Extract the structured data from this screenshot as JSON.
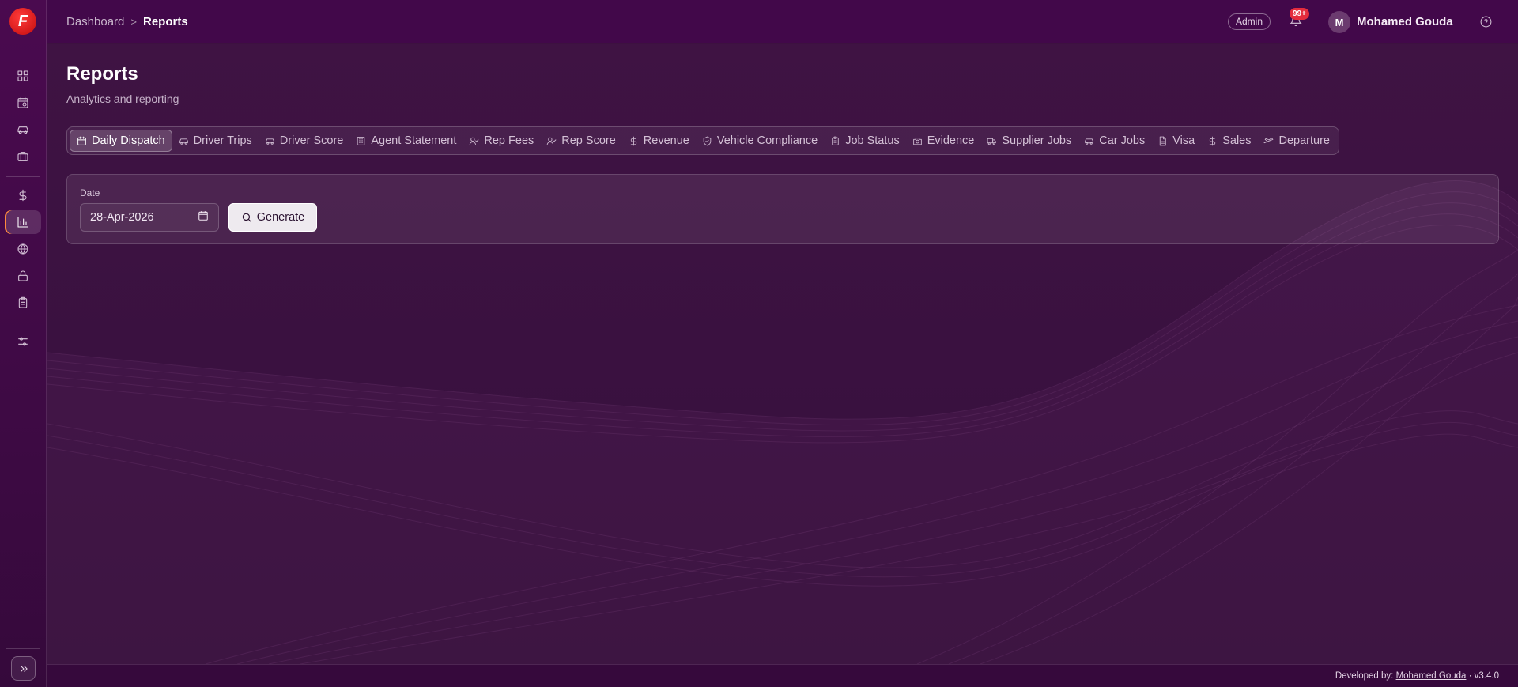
{
  "sidebar": {
    "logo": "F",
    "icons": [
      "dashboard-icon",
      "calendar-clock-icon",
      "car-icon",
      "briefcase-icon",
      "dollar-icon",
      "bar-chart-icon",
      "globe-icon",
      "lock-icon",
      "clipboard-icon",
      "sliders-icon"
    ],
    "active": "bar-chart-icon",
    "expand_icon": "chevrons-right-icon"
  },
  "header": {
    "breadcrumb": {
      "home": "Dashboard",
      "separator": ">",
      "current": "Reports"
    },
    "role": "Admin",
    "notifications": "99+",
    "avatar_initial": "M",
    "user_name": "Mohamed Gouda"
  },
  "page": {
    "title": "Reports",
    "subtitle": "Analytics and reporting"
  },
  "tabs": [
    {
      "label": "Daily Dispatch",
      "icon": "calendar-icon",
      "active": true
    },
    {
      "label": "Driver Trips",
      "icon": "car-icon"
    },
    {
      "label": "Driver Score",
      "icon": "car-icon"
    },
    {
      "label": "Agent Statement",
      "icon": "building-icon"
    },
    {
      "label": "Rep Fees",
      "icon": "user-check-icon"
    },
    {
      "label": "Rep Score",
      "icon": "user-check-icon"
    },
    {
      "label": "Revenue",
      "icon": "dollar-icon"
    },
    {
      "label": "Vehicle Compliance",
      "icon": "shield-check-icon"
    },
    {
      "label": "Job Status",
      "icon": "clipboard-icon"
    },
    {
      "label": "Evidence",
      "icon": "camera-icon"
    },
    {
      "label": "Supplier Jobs",
      "icon": "truck-icon"
    },
    {
      "label": "Car Jobs",
      "icon": "car-icon"
    },
    {
      "label": "Visa",
      "icon": "file-icon"
    },
    {
      "label": "Sales",
      "icon": "dollar-icon"
    },
    {
      "label": "Departure",
      "icon": "plane-icon"
    }
  ],
  "form": {
    "date_label": "Date",
    "date_value": "28-Apr-2026",
    "generate_label": "Generate"
  },
  "footer": {
    "prefix": "Developed by:",
    "author": "Mohamed Gouda",
    "version": "· v3.4.0"
  },
  "colors": {
    "background": "#3d1140",
    "header": "#42084a",
    "accent_active": "#ff8a3d",
    "notification": "#e42c3d",
    "logo": "#d41414"
  }
}
